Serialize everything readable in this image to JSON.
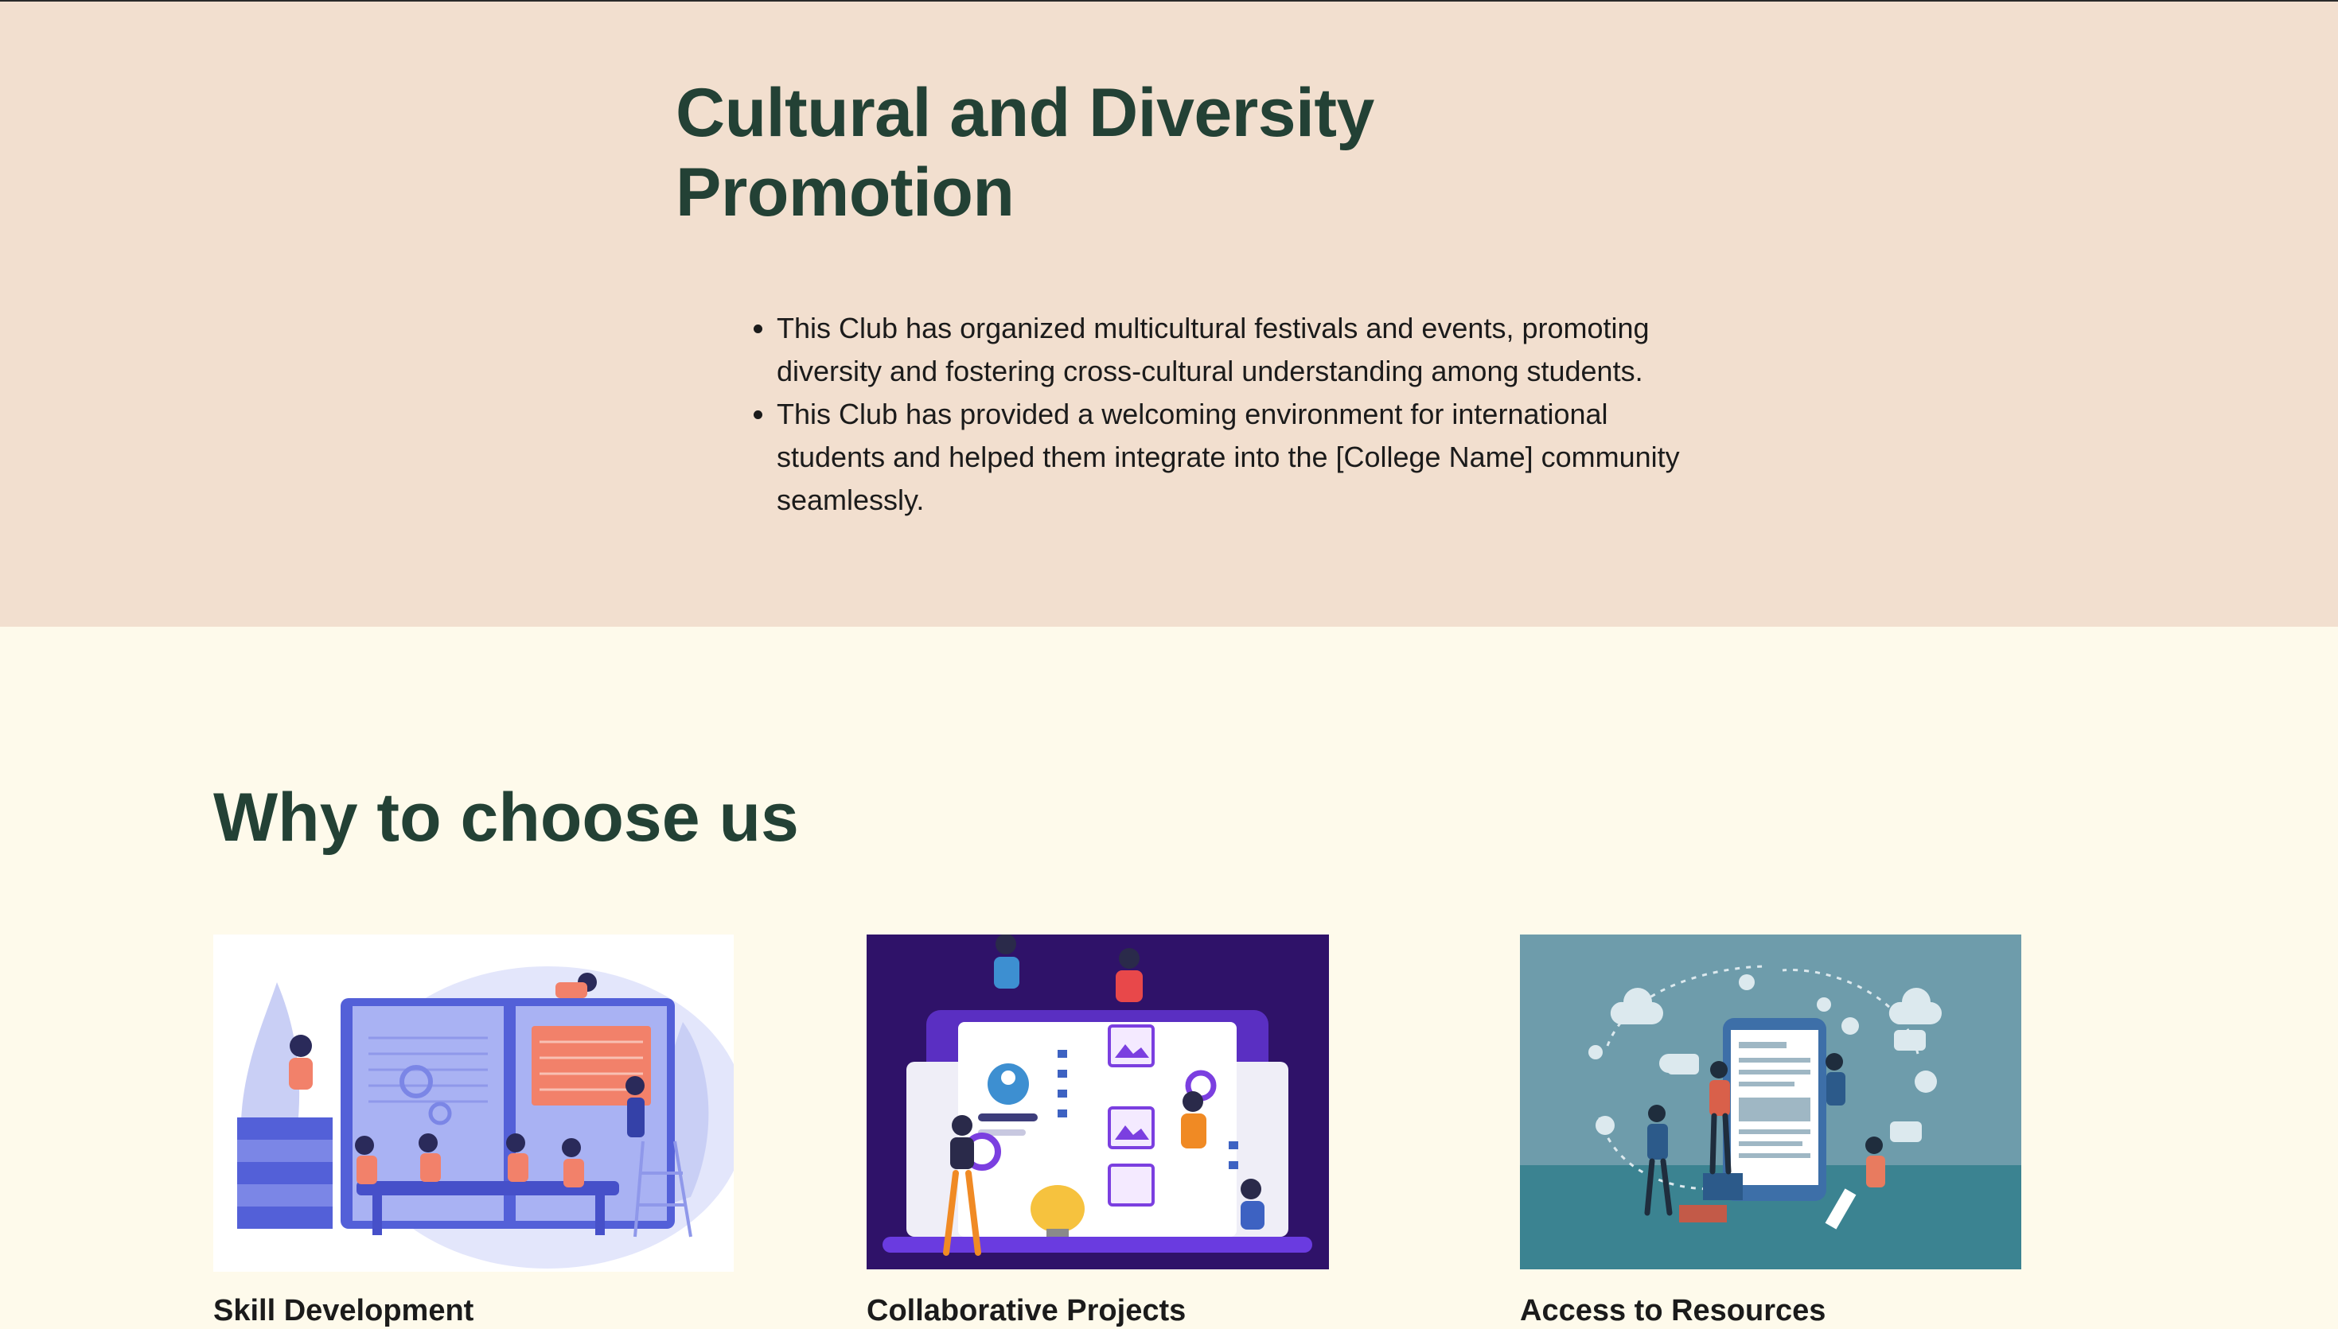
{
  "culture": {
    "title": "Cultural and Diversity Promotion",
    "bullets": [
      "This Club has organized multicultural festivals and events, promoting diversity and fostering cross-cultural understanding among students.",
      "This Club has provided a welcoming environment for international students and helped them integrate into the [College Name] community seamlessly."
    ]
  },
  "why": {
    "heading": "Why to choose us",
    "cards": [
      {
        "title": "Skill Development",
        "illustration": "students-studying-book-illustration"
      },
      {
        "title": "Collaborative Projects",
        "illustration": "team-building-website-illustration"
      },
      {
        "title": "Access to Resources",
        "illustration": "mobile-app-resources-illustration"
      }
    ]
  },
  "colors": {
    "heading": "#234135",
    "culture_bg": "#f2dfcf",
    "page_bg": "#fefaeb",
    "accent_purple": "#2f1269",
    "accent_teal": "#6e9cab"
  }
}
